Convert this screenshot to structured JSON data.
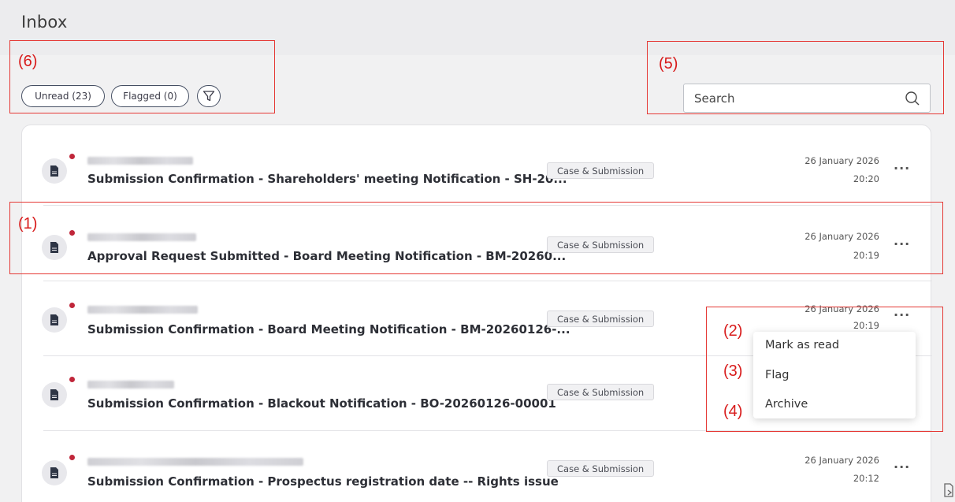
{
  "page": {
    "title": "Inbox"
  },
  "filters": {
    "unread_label": "Unread (23)",
    "flagged_label": "Flagged (0)"
  },
  "search": {
    "placeholder": "Search"
  },
  "messages": [
    {
      "subject": "Submission Confirmation - Shareholders' meeting Notification - SH-20...",
      "tag": "Case & Submission",
      "date": "26 January 2026",
      "time": "20:20",
      "unread": true
    },
    {
      "subject": "Approval Request Submitted - Board Meeting Notification - BM-20260...",
      "tag": "Case & Submission",
      "date": "26 January 2026",
      "time": "20:19",
      "unread": true
    },
    {
      "subject": "Submission Confirmation - Board Meeting Notification - BM-20260126-...",
      "tag": "Case & Submission",
      "date": "26 January 2026",
      "time": "20:19",
      "unread": true
    },
    {
      "subject": "Submission Confirmation - Blackout Notification - BO-20260126-00001",
      "tag": "Case & Submission",
      "date": "",
      "time": "",
      "unread": true
    },
    {
      "subject": "Submission Confirmation - Prospectus registration date -- Rights issue",
      "tag": "Case & Submission",
      "date": "26 January 2026",
      "time": "20:12",
      "unread": true
    }
  ],
  "context_menu": {
    "items": [
      "Mark as read",
      "Flag",
      "Archive"
    ]
  },
  "annotations": [
    "(1)",
    "(2)",
    "(3)",
    "(4)",
    "(5)",
    "(6)"
  ],
  "icons": {
    "filter": "filter-icon",
    "search": "search-icon",
    "document": "document-icon",
    "more": "more-options-icon"
  },
  "colors": {
    "annotation": "#e53935",
    "unread_dot": "#c0263a",
    "pill_border": "#454f63"
  }
}
